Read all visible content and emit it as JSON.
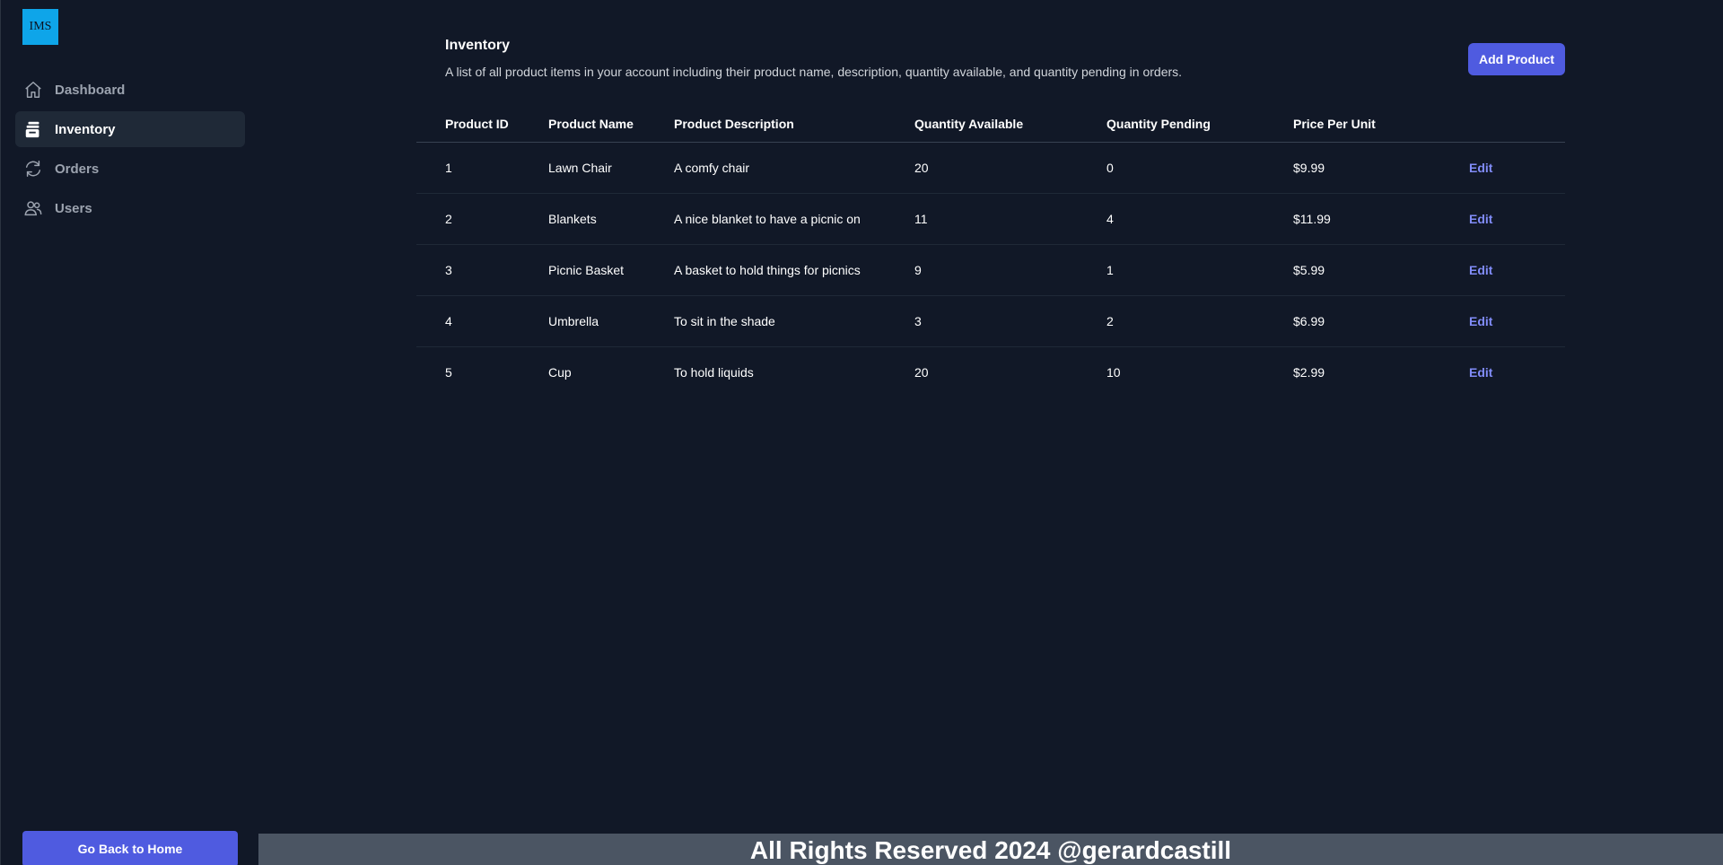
{
  "logo": {
    "text": "IMS",
    "color": "#0ea5e9"
  },
  "sidebar": {
    "items": [
      {
        "label": "Dashboard",
        "icon": "home-icon",
        "active": false
      },
      {
        "label": "Inventory",
        "icon": "inventory-icon",
        "active": true
      },
      {
        "label": "Orders",
        "icon": "refresh-icon",
        "active": false
      },
      {
        "label": "Users",
        "icon": "users-icon",
        "active": false
      }
    ],
    "home_button": "Go Back to Home"
  },
  "header": {
    "title": "Inventory",
    "description": "A list of all product items in your account including their product name, description, quantity available, and quantity pending in orders.",
    "add_button": "Add Product"
  },
  "table": {
    "columns": [
      "Product ID",
      "Product Name",
      "Product Description",
      "Quantity Available",
      "Quantity Pending",
      "Price Per Unit"
    ],
    "rows": [
      {
        "id": "1",
        "name": "Lawn Chair",
        "description": "A comfy chair",
        "qty_available": "20",
        "qty_pending": "0",
        "price": "$9.99",
        "action": "Edit"
      },
      {
        "id": "2",
        "name": "Blankets",
        "description": "A nice blanket to have a picnic on",
        "qty_available": "11",
        "qty_pending": "4",
        "price": "$11.99",
        "action": "Edit"
      },
      {
        "id": "3",
        "name": "Picnic Basket",
        "description": "A basket to hold things for picnics",
        "qty_available": "9",
        "qty_pending": "1",
        "price": "$5.99",
        "action": "Edit"
      },
      {
        "id": "4",
        "name": "Umbrella",
        "description": "To sit in the shade",
        "qty_available": "3",
        "qty_pending": "2",
        "price": "$6.99",
        "action": "Edit"
      },
      {
        "id": "5",
        "name": "Cup",
        "description": "To hold liquids",
        "qty_available": "20",
        "qty_pending": "10",
        "price": "$2.99",
        "action": "Edit"
      }
    ]
  },
  "footer": {
    "text": "All Rights Reserved 2024 @gerardcastill"
  },
  "colors": {
    "background": "#111827",
    "accent": "#4f5be0",
    "link": "#818cf8",
    "footer": "#4b5563"
  }
}
